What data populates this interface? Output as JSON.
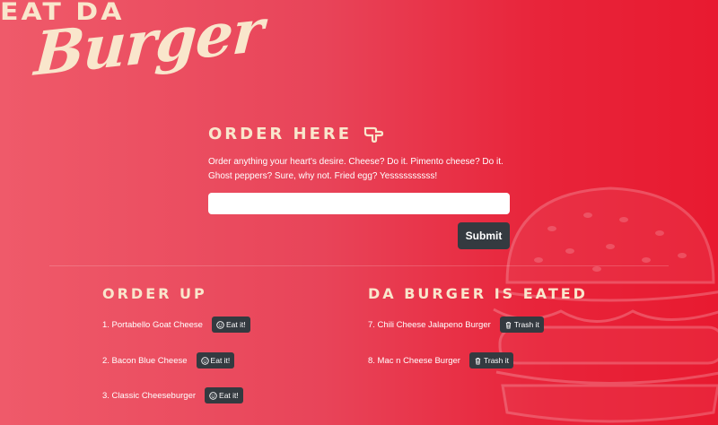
{
  "logo": {
    "top_text": "EAT DA",
    "script_text": "Burger"
  },
  "order": {
    "title": "ORDER HERE",
    "description": "Order anything your heart's desire. Cheese? Do it. Pimento cheese? Do it. Ghost peppers? Sure, why not. Fried egg? Yessssssssss!",
    "input_value": "",
    "submit_label": "Submit"
  },
  "order_up": {
    "title": "ORDER UP",
    "button_label": "Eat it!",
    "items": [
      {
        "label": "1. Portabello Goat Cheese"
      },
      {
        "label": "2. Bacon Blue Cheese"
      },
      {
        "label": "3. Classic Cheeseburger"
      }
    ]
  },
  "eated": {
    "title": "DA BURGER IS EATED",
    "button_label": "Trash it",
    "items": [
      {
        "label": "7. Chili Cheese Jalapeno Burger"
      },
      {
        "label": "8. Mac n Cheese Burger"
      }
    ]
  },
  "colors": {
    "accent": "#f9e6cc",
    "button": "#343a40",
    "bg_start": "#ef5a6a",
    "bg_end": "#e81a30"
  },
  "icons": {
    "order_title": "pointing-hand-icon",
    "eat": "smile-icon",
    "trash": "trash-icon",
    "background": "burger-illustration"
  }
}
